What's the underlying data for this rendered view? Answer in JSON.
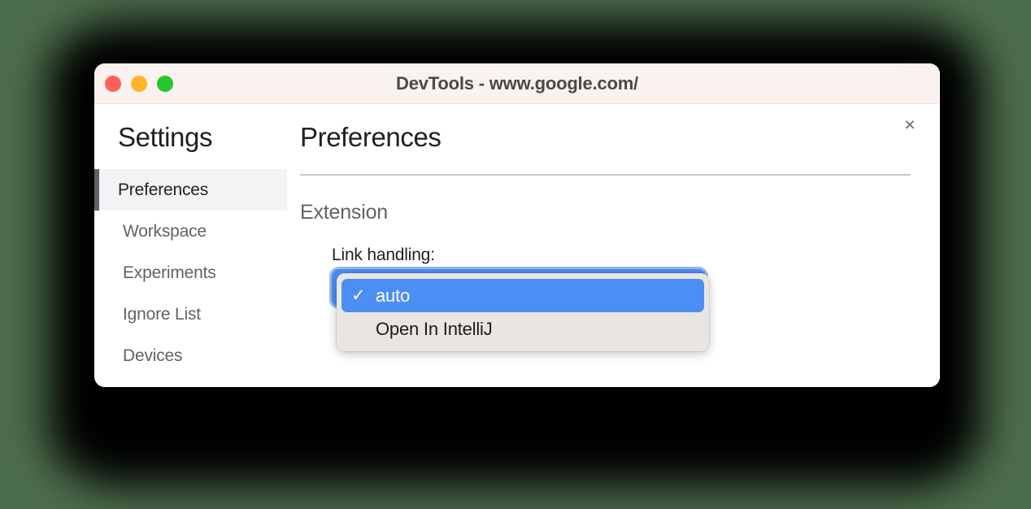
{
  "window": {
    "title": "DevTools - www.google.com/",
    "traffic_lights": [
      {
        "name": "close",
        "color": "#fc6157"
      },
      {
        "name": "minimize",
        "color": "#fdb62a"
      },
      {
        "name": "zoom",
        "color": "#29c432"
      }
    ]
  },
  "dialog": {
    "close_icon": "×",
    "sidebar": {
      "title": "Settings",
      "items": [
        {
          "label": "Preferences",
          "selected": true
        },
        {
          "label": "Workspace",
          "selected": false
        },
        {
          "label": "Experiments",
          "selected": false
        },
        {
          "label": "Ignore List",
          "selected": false
        },
        {
          "label": "Devices",
          "selected": false
        }
      ]
    },
    "main": {
      "title": "Preferences",
      "section_title": "Extension",
      "field": {
        "label": "Link handling:",
        "selected_value": "auto",
        "options": [
          {
            "label": "auto",
            "checked": true
          },
          {
            "label": "Open In IntelliJ",
            "checked": false
          }
        ],
        "check_glyph": "✓"
      }
    }
  },
  "colors": {
    "desktop_background": "#4d6e4d",
    "titlebar": "#faf2ee",
    "accent_blue": "#4b8ef4",
    "popup_background": "#e9e6e1",
    "selected_item_background": "#f1f3f4"
  }
}
